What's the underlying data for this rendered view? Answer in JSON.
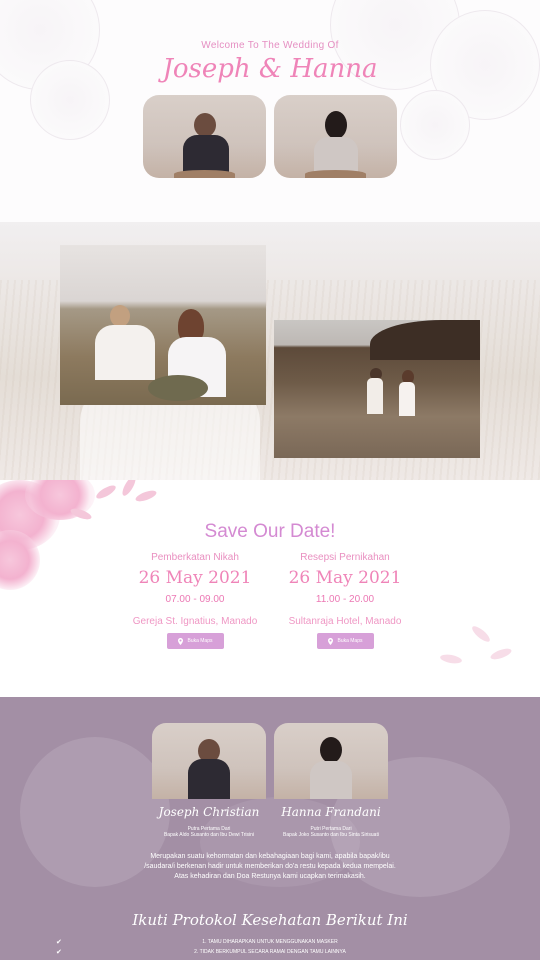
{
  "hero": {
    "welcome": "Welcome To The Wedding Of",
    "names": "Joseph & Hanna"
  },
  "save_date": {
    "title": "Save Our Date!",
    "events": [
      {
        "title": "Pemberkatan Nikah",
        "date": "26 May 2021",
        "time": "07.00 - 09.00",
        "place": "Gereja St. Ignatius, Manado",
        "button": "Buka Maps"
      },
      {
        "title": "Resepsi Pernikahan",
        "date": "26 May 2021",
        "time": "11.00 - 20.00",
        "place": "Sultanraja Hotel, Manado",
        "button": "Buka Maps"
      }
    ]
  },
  "couple": {
    "groom": {
      "name": "Joseph Christian",
      "line1": "Putra Pertama Dari",
      "line2": "Bapak Aldo Susanto dan Ibu Dewi Trisini"
    },
    "bride": {
      "name": "Hanna Frandani",
      "line1": "Putri Pertama Dari",
      "line2": "Bapak Joko Susanto dan Ibu Sinta Sirisuati"
    },
    "message_line1": "Merupakan suatu kehormatan dan kebahagiaan bagi kami, apabila bapak/ibu",
    "message_line2": "/saudara/i berkenan hadir untuk memberikan do'a restu kepada kedua mempelai.",
    "message_line3": "Atas kehadiran dan Doa Restunya kami ucapkan terimakasih."
  },
  "protocol": {
    "title": "Ikuti Protokol Kesehatan Berikut Ini",
    "items": [
      "1. TAMU DIHARAPKAN UNTUK MENGGUNAKAN MASKER",
      "2. TIDAK BERKUMPUL SECARA RAMAI DENGAN TAMU LAINNYA"
    ]
  },
  "icons": {
    "maps": "map-pin-icon",
    "check": "check-icon"
  },
  "colors": {
    "pink": "#ef84b8",
    "lavender_button": "#d7a0d8",
    "mauve_bg": "#a38fa5"
  }
}
